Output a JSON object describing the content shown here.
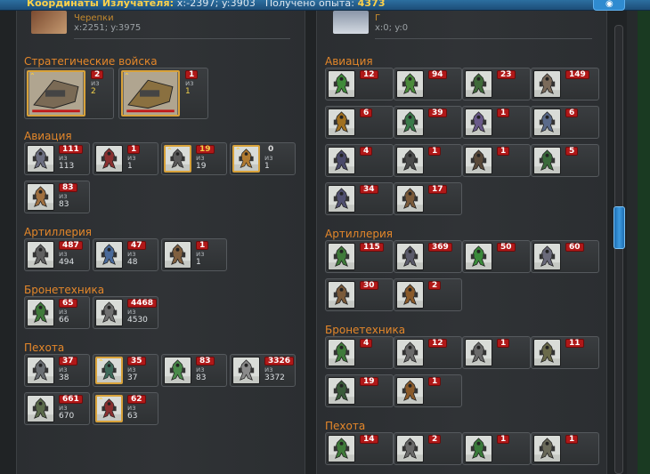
{
  "topbar": {
    "coord_label": "Координаты Излучателя:",
    "coord_value": "x:-2397; y:3903",
    "exp_label": "Получено опыта:",
    "exp_value": "4373"
  },
  "left": {
    "subtitle": "Черепки",
    "coords": "x:2251; y:3975",
    "sections": [
      {
        "title": "Стратегические войска",
        "units": [
          {
            "count": "2",
            "of": "из",
            "total": "2",
            "gold": true,
            "big": true,
            "c": "#7a6a55"
          },
          {
            "count": "1",
            "of": "из",
            "total": "1",
            "gold": true,
            "big": true,
            "c": "#8a7040"
          }
        ]
      },
      {
        "title": "Авиация",
        "units": [
          {
            "count": "111",
            "of": "из",
            "total": "113",
            "c": "#6b6e80"
          },
          {
            "count": "1",
            "of": "из",
            "total": "1",
            "c": "#8a3030"
          },
          {
            "count": "19",
            "of": "из",
            "total": "19",
            "gold": true,
            "yellow": true,
            "c": "#5a5a5a"
          },
          {
            "count": "0",
            "of": "из",
            "total": "1",
            "gold": true,
            "plain": true,
            "c": "#b07a30"
          },
          {
            "count": "83",
            "of": "из",
            "total": "83",
            "c": "#a07040"
          }
        ]
      },
      {
        "title": "Артиллерия",
        "units": [
          {
            "count": "487",
            "of": "из",
            "total": "494",
            "c": "#606060"
          },
          {
            "count": "47",
            "of": "из",
            "total": "48",
            "c": "#4a6a9a"
          },
          {
            "count": "1",
            "of": "из",
            "total": "1",
            "c": "#806040"
          }
        ]
      },
      {
        "title": "Бронетехника",
        "units": [
          {
            "count": "65",
            "of": "из",
            "total": "66",
            "c": "#3f7a3a"
          },
          {
            "count": "4468",
            "of": "из",
            "total": "4530",
            "c": "#707070"
          }
        ]
      },
      {
        "title": "Пехота",
        "units": [
          {
            "count": "37",
            "of": "из",
            "total": "38",
            "c": "#6a6e72"
          },
          {
            "count": "35",
            "of": "из",
            "total": "37",
            "gold": true,
            "c": "#3f6a5a"
          },
          {
            "count": "83",
            "of": "из",
            "total": "83",
            "c": "#4a8a4a"
          },
          {
            "count": "3326",
            "of": "из",
            "total": "3372",
            "c": "#8a8a8a"
          },
          {
            "count": "661",
            "of": "из",
            "total": "670",
            "c": "#5a6a4a"
          },
          {
            "count": "62",
            "of": "из",
            "total": "63",
            "gold": true,
            "c": "#8a3030"
          }
        ]
      }
    ]
  },
  "right": {
    "subtitle": "Г",
    "coords": "x:0; y:0",
    "sections": [
      {
        "title": "Авиация",
        "units": [
          {
            "count": "12",
            "c": "#3f8a3a"
          },
          {
            "count": "94",
            "c": "#4a8a3a"
          },
          {
            "count": "23",
            "c": "#3f6a3a"
          },
          {
            "count": "149",
            "c": "#7a6a5a"
          },
          {
            "count": "6",
            "c": "#a07020"
          },
          {
            "count": "39",
            "c": "#3a7a4a"
          },
          {
            "count": "1",
            "c": "#6a5a8a"
          },
          {
            "count": "6",
            "c": "#5a6a8a"
          },
          {
            "count": "4",
            "c": "#4a4a6a"
          },
          {
            "count": "1",
            "c": "#4a4a4a"
          },
          {
            "count": "1",
            "c": "#5a4a3a"
          },
          {
            "count": "5",
            "c": "#3a6a3a"
          },
          {
            "count": "34",
            "c": "#505070"
          },
          {
            "count": "17",
            "c": "#7a5a3a"
          }
        ]
      },
      {
        "title": "Артиллерия",
        "units": [
          {
            "count": "115",
            "c": "#3f7a3a"
          },
          {
            "count": "369",
            "c": "#5a5a6a"
          },
          {
            "count": "50",
            "c": "#3a8a3a"
          },
          {
            "count": "60",
            "c": "#6a6a7a"
          },
          {
            "count": "30",
            "c": "#7a5a3a"
          },
          {
            "count": "2",
            "c": "#8a5a2a"
          }
        ]
      },
      {
        "title": "Бронетехника",
        "units": [
          {
            "count": "4",
            "c": "#3f7a3a"
          },
          {
            "count": "12",
            "c": "#6a6a6a"
          },
          {
            "count": "1",
            "c": "#6a6a6a"
          },
          {
            "count": "11",
            "c": "#6a6a4a"
          },
          {
            "count": "19",
            "c": "#3a5a3a"
          },
          {
            "count": "1",
            "c": "#8a5a2a"
          }
        ]
      },
      {
        "title": "Пехота",
        "units": [
          {
            "count": "14",
            "c": "#3f7a3a"
          },
          {
            "count": "2",
            "c": "#6a6a6a"
          },
          {
            "count": "1",
            "c": "#3a7a3a"
          },
          {
            "count": "1",
            "c": "#6a6a5a"
          }
        ]
      }
    ]
  }
}
